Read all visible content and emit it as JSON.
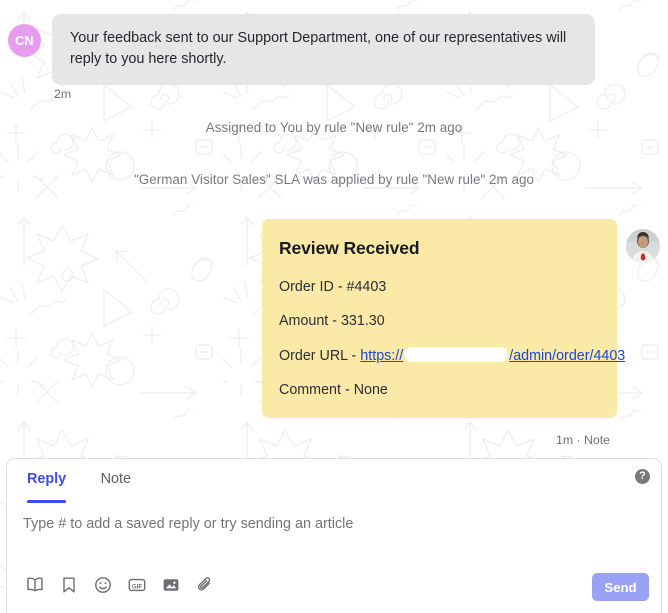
{
  "colors": {
    "accent": "#3b4bf0",
    "send_button": "#9aa2f5",
    "note_card": "#fbe9a8",
    "incoming_bubble": "#e6e6e6",
    "avatar_initials_bg": "#e79ded",
    "link": "#1b47d6",
    "muted_text": "#77797d"
  },
  "thread": {
    "incoming_message": {
      "avatar_initials": "CN",
      "text": "Your feedback sent to our Support Department, one of our representatives will reply to you here shortly.",
      "time": "2m"
    },
    "system_events": [
      {
        "text": "Assigned to You by rule \"New rule\" 2m ago"
      },
      {
        "text": "\"German Visitor Sales\" SLA was applied by rule \"New rule\" 2m ago"
      }
    ],
    "note": {
      "title": "Review Received",
      "rows": [
        {
          "label": "Order ID - ",
          "value": "#4403"
        },
        {
          "label": "Amount - ",
          "value": "331.30"
        },
        {
          "label": "Comment - ",
          "value": "None"
        }
      ],
      "url_row": {
        "label": "Order URL - ",
        "link_prefix": "https://",
        "link_suffix": "/admin/order/4403",
        "redacted": true
      },
      "meta": "1m · Note"
    }
  },
  "composer": {
    "tabs": [
      {
        "label": "Reply",
        "active": true
      },
      {
        "label": "Note",
        "active": false
      }
    ],
    "help_icon": "?",
    "input": {
      "value": "",
      "placeholder": "Type # to add a saved reply or try sending an article"
    },
    "toolbar_icons": [
      {
        "name": "book-icon",
        "title": "Articles"
      },
      {
        "name": "bookmark-icon",
        "title": "Saved replies"
      },
      {
        "name": "emoji-icon",
        "title": "Emoji"
      },
      {
        "name": "gif-icon",
        "title": "GIF"
      },
      {
        "name": "image-icon",
        "title": "Image"
      },
      {
        "name": "attachment-icon",
        "title": "Attach file"
      }
    ],
    "send_label": "Send"
  }
}
